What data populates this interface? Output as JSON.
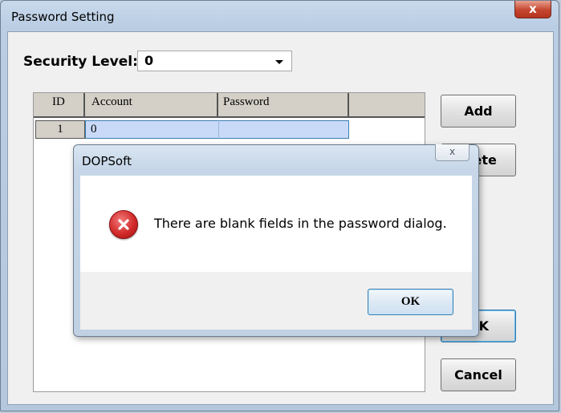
{
  "window": {
    "title": "Password Setting",
    "close_glyph": "x"
  },
  "security": {
    "label": "Security Level:",
    "value": "0"
  },
  "table": {
    "columns": [
      "ID",
      "Account",
      "Password"
    ],
    "rows": [
      {
        "id": "1",
        "account": "0",
        "password": ""
      }
    ]
  },
  "buttons": {
    "add": "Add",
    "delete": "Delete",
    "delete_visible": "elete",
    "ok": "OK",
    "cancel": "Cancel"
  },
  "dialog": {
    "title": "DOPSoft",
    "close_glyph": "x",
    "message": "There are blank fields in the password dialog.",
    "ok_label": "OK",
    "icon": "error-icon"
  },
  "colors": {
    "error_red": "#d22a2a",
    "selection_blue": "#c9daf8",
    "focus_blue": "#3c7fb1"
  }
}
